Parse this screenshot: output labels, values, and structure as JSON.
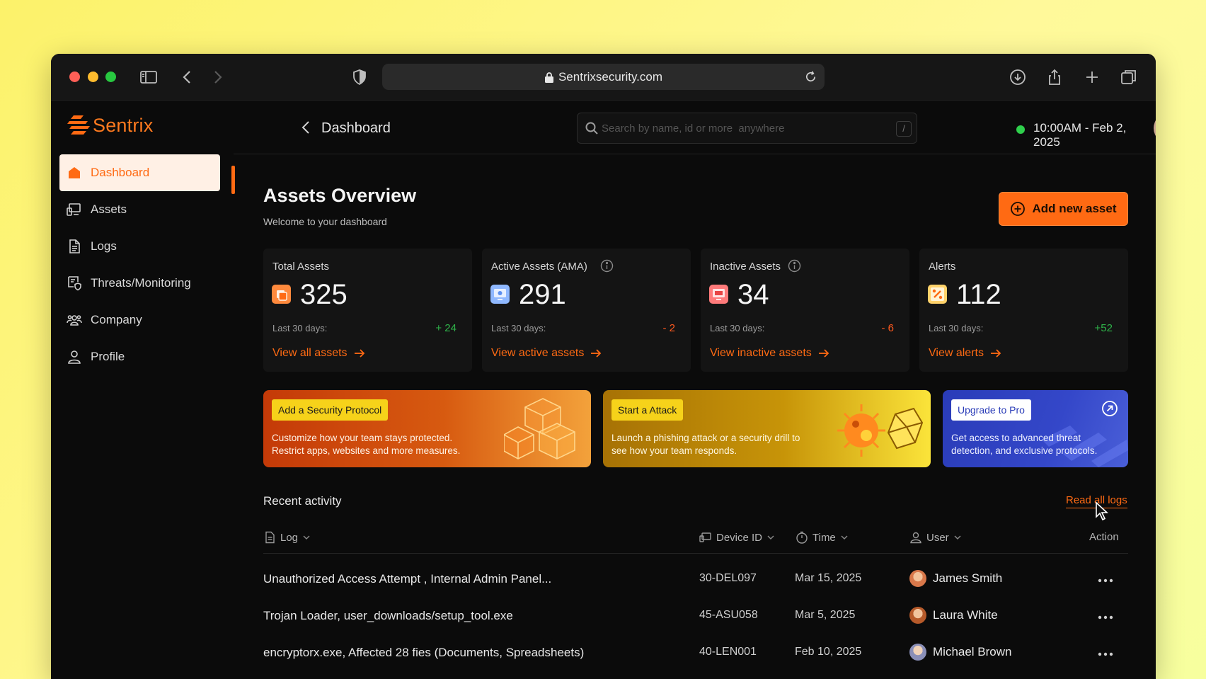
{
  "browser": {
    "url": "Sentrixsecurity.com"
  },
  "brand": {
    "name": "Sentrix",
    "accent": "#ff6a13"
  },
  "sidebar": {
    "items": [
      {
        "label": "Dashboard",
        "icon": "home-icon",
        "active": true
      },
      {
        "label": "Assets",
        "icon": "devices-icon"
      },
      {
        "label": "Logs",
        "icon": "document-icon"
      },
      {
        "label": "Threats/Monitoring",
        "icon": "monitor-shield-icon"
      },
      {
        "label": "Company",
        "icon": "team-icon"
      },
      {
        "label": "Profile",
        "icon": "user-icon"
      }
    ]
  },
  "header": {
    "breadcrumb": "Dashboard",
    "search_placeholder": "Search by name, id or more  anywhere",
    "search_shortcut": "/",
    "datetime": "10:00AM - Feb 2, 2025",
    "status_color": "#2fcf4c"
  },
  "main": {
    "title": "Assets Overview",
    "subtitle": "Welcome to your dashboard",
    "add_button": "Add new asset"
  },
  "stats": [
    {
      "title": "Total Assets",
      "value": "325",
      "period": "Last 30 days:",
      "delta": "+ 24",
      "link": "View all assets"
    },
    {
      "title": "Active Assets (AMA)",
      "value": "291",
      "period": "Last 30 days:",
      "delta": "- 2",
      "link": "View active assets"
    },
    {
      "title": "Inactive Assets",
      "value": "34",
      "period": "Last 30 days:",
      "delta": "- 6",
      "link": "View inactive assets"
    },
    {
      "title": "Alerts",
      "value": "112",
      "period": "Last 30 days:",
      "delta": "+52",
      "link": "View alerts"
    }
  ],
  "promos": [
    {
      "tag": "Add a Security Protocol",
      "line1": "Customize how your team stays protected.",
      "line2": "Restrict apps, websites and more measures."
    },
    {
      "tag": "Start a Attack",
      "line1": "Launch a phishing attack or a security drill to",
      "line2": "see how your team responds."
    },
    {
      "tag": "Upgrade to Pro",
      "line1": "Get access to advanced threat",
      "line2": "detection, and exclusive protocols."
    }
  ],
  "activity": {
    "title": "Recent activity",
    "read_all": "Read all logs",
    "columns": {
      "log": "Log",
      "device": "Device ID",
      "time": "Time",
      "user": "User",
      "action": "Action"
    },
    "rows": [
      {
        "log": "Unauthorized Access Attempt , Internal Admin Panel...",
        "device": "30-DEL097",
        "time": "Mar 15, 2025",
        "user": "James Smith"
      },
      {
        "log": "Trojan Loader,  user_downloads/setup_tool.exe",
        "device": "45-ASU058",
        "time": "Mar 5, 2025",
        "user": "Laura White"
      },
      {
        "log": "encryptorx.exe,  Affected 28 fies (Documents, Spreadsheets)",
        "device": "40-LEN001",
        "time": "Feb 10, 2025",
        "user": "Michael Brown"
      }
    ]
  }
}
